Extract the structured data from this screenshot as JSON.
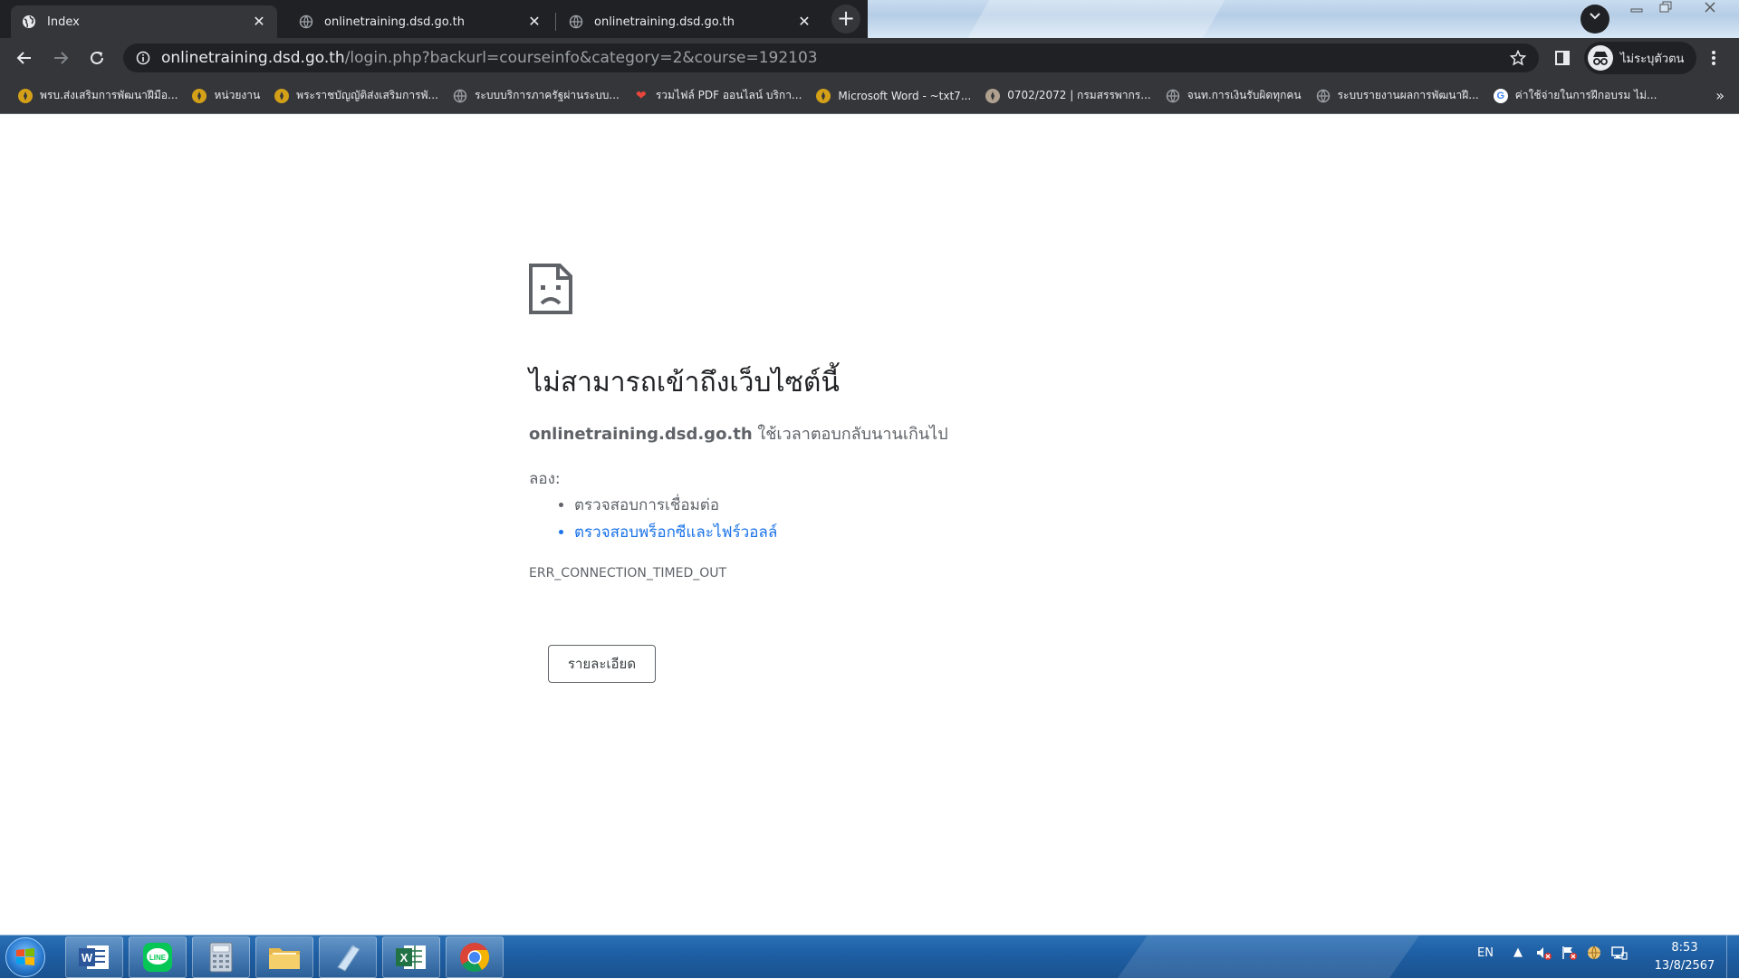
{
  "browser": {
    "tabs": [
      {
        "title": "Index",
        "active": true,
        "icon": "globe-icon"
      },
      {
        "title": "onlinetraining.dsd.go.th",
        "active": false,
        "icon": "globe-icon"
      },
      {
        "title": "onlinetraining.dsd.go.th",
        "active": false,
        "icon": "globe-icon"
      }
    ],
    "url_host": "onlinetraining.dsd.go.th",
    "url_path": "/login.php?backurl=courseinfo&category=2&course=192103",
    "profile_label": "ไม่ระบุตัวตน",
    "bookmarks": [
      {
        "label": "พรบ.ส่งเสริมการพัฒนาฝีมือ...",
        "icon": "seal-icon",
        "color": "#d4a017"
      },
      {
        "label": "หน่วยงาน",
        "icon": "seal-icon",
        "color": "#d4a017"
      },
      {
        "label": "พระราชบัญญัติส่งเสริมการพั...",
        "icon": "seal-icon",
        "color": "#d4a017"
      },
      {
        "label": "ระบบบริการภาครัฐผ่านระบบ...",
        "icon": "globe-icon",
        "color": "#9aa0a6"
      },
      {
        "label": "รวมไฟล์ PDF ออนไลน์ บริกา...",
        "icon": "heart-icon",
        "color": "#e8453c"
      },
      {
        "label": "Microsoft Word - ~txt7...",
        "icon": "seal-icon",
        "color": "#d4a017"
      },
      {
        "label": "0702/2072 | กรมสรรพากร...",
        "icon": "seal-icon",
        "color": "#b0a090"
      },
      {
        "label": "จนท.การเงินรับผิดทุกคน",
        "icon": "globe-icon",
        "color": "#9aa0a6"
      },
      {
        "label": "ระบบรายงานผลการพัฒนาฝี...",
        "icon": "globe-icon",
        "color": "#9aa0a6"
      },
      {
        "label": "ค่าใช้จ่ายในการฝึกอบรม ไม่...",
        "icon": "google-icon",
        "color": "#ffffff"
      }
    ]
  },
  "error_page": {
    "title": "ไม่สามารถเข้าถึงเว็บไซต์นี้",
    "host": "onlinetraining.dsd.go.th",
    "desc_suffix": " ใช้เวลาตอบกลับนานเกินไป",
    "try_label": "ลอง:",
    "suggestions": [
      "ตรวจสอบการเชื่อมต่อ",
      "ตรวจสอบพร็อกซีและไฟร์วอลล์"
    ],
    "error_code": "ERR_CONNECTION_TIMED_OUT",
    "details_button": "รายละเอียด"
  },
  "taskbar": {
    "apps": [
      "word-icon",
      "line-icon",
      "calculator-icon",
      "folder-icon",
      "notepad-icon",
      "excel-icon",
      "chrome-icon"
    ],
    "lang": "EN",
    "time": "8:53",
    "date": "13/8/2567"
  }
}
